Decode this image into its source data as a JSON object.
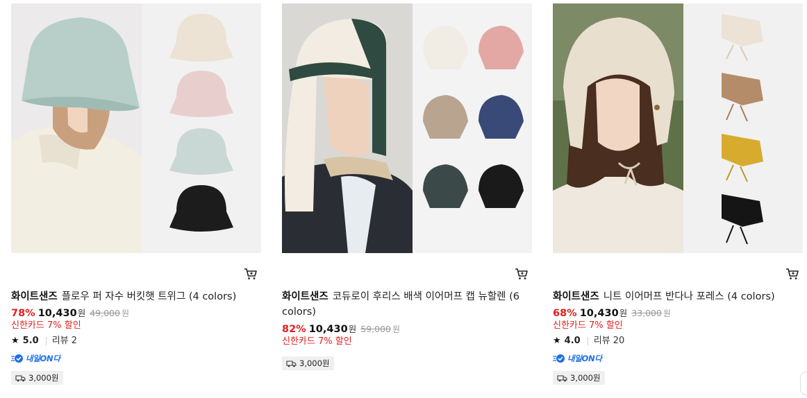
{
  "products": [
    {
      "brand": "화이트샌즈",
      "name": "플로우 퍼 자수 버킷햇 트위그 (4 colors)",
      "discount": "78%",
      "price": "10,430",
      "currency": "원",
      "original_price": "49,000",
      "card_promo": "신한카드 7% 할인",
      "rating": "5.0",
      "reviews_label": "리뷰",
      "reviews": "2",
      "delivery_badge": "내일ON다",
      "shipping_fee": "3,000원",
      "swatch_colors": [
        "#ece3d4",
        "#e8cfcd",
        "#c9d8d4",
        "#1c1c1c"
      ],
      "main_hat_color": "#b7cfc8"
    },
    {
      "brand": "화이트샌즈",
      "name": "코듀로이 후리스 배색 이어머프 캡 뉴할렌 (6 colors)",
      "discount": "82%",
      "price": "10,430",
      "currency": "원",
      "original_price": "59,000",
      "card_promo": "신한카드 7% 할인",
      "shipping_fee": "3,000원",
      "swatch_colors": [
        "#f1ece4",
        "#e3a8a4",
        "#b8a48f",
        "#3a4a78",
        "#3b4a48",
        "#1a1a1a"
      ],
      "main_hat_color": "#2f4a40"
    },
    {
      "brand": "화이트샌즈",
      "name": "니트 이어머프 반다나 포레스 (4 colors)",
      "discount": "68%",
      "price": "10,430",
      "currency": "원",
      "original_price": "33,000",
      "card_promo": "신한카드 7% 할인",
      "rating": "4.0",
      "reviews_label": "리뷰",
      "reviews": "20",
      "delivery_badge": "내일ON다",
      "shipping_fee": "3,000원",
      "swatch_colors": [
        "#ece3d6",
        "#b48c6a",
        "#d6ab2e",
        "#151515"
      ],
      "main_hat_color": "#e9dfcf"
    }
  ],
  "colors": {
    "discount": "#e0201f",
    "delivery_brand": "#1f6fe8",
    "badge_bg": "#f0f0f0"
  },
  "icons": {
    "cart": "cart-icon",
    "star": "star-icon",
    "truck": "truck-icon",
    "delivery": "rocket-delivery-icon"
  }
}
